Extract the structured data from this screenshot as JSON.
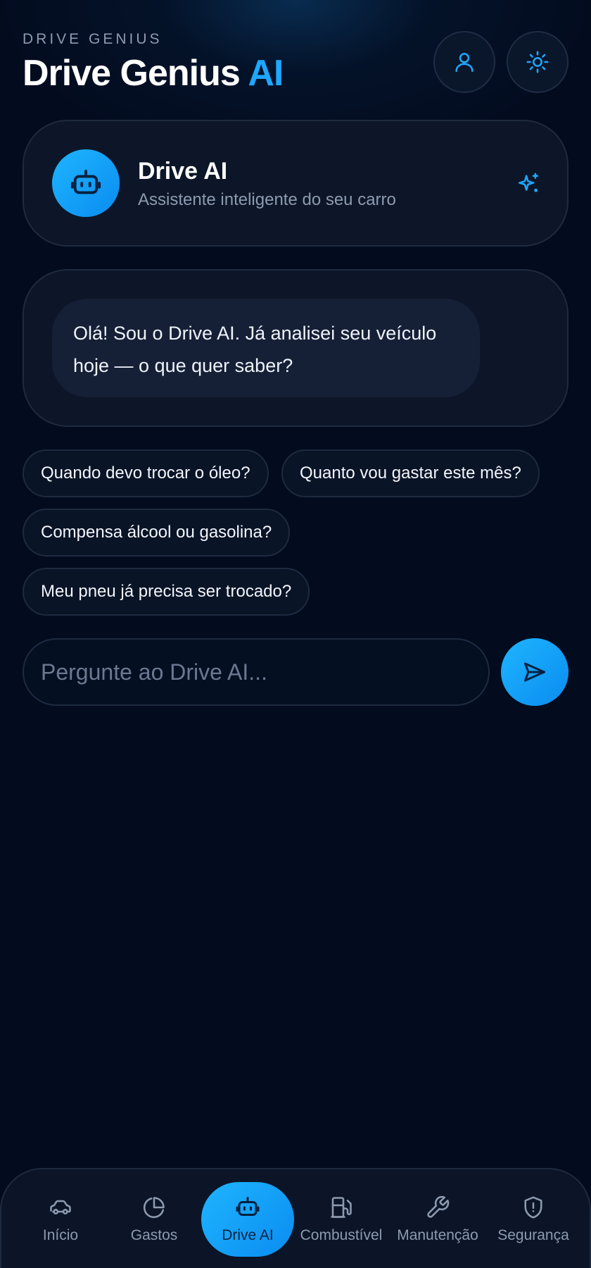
{
  "header": {
    "eyebrow": "DRIVE GENIUS",
    "title_main": "Drive Genius",
    "title_accent": "AI"
  },
  "assistant": {
    "name": "Drive AI",
    "subtitle": "Assistente inteligente do seu carro"
  },
  "chat": {
    "messages": [
      {
        "from": "assistant",
        "text": "Olá! Sou o Drive AI. Já analisei seu veículo hoje — o que quer saber?"
      }
    ]
  },
  "suggestions": [
    "Quando devo trocar o óleo?",
    "Quanto vou gastar este mês?",
    "Compensa álcool ou gasolina?",
    "Meu pneu já precisa ser trocado?"
  ],
  "composer": {
    "placeholder": "Pergunte ao Drive AI...",
    "value": ""
  },
  "nav": {
    "active": "Drive AI",
    "items": [
      {
        "label": "Início",
        "icon": "car-icon"
      },
      {
        "label": "Gastos",
        "icon": "pie-chart-icon"
      },
      {
        "label": "Drive AI",
        "icon": "robot-icon"
      },
      {
        "label": "Combustível",
        "icon": "fuel-pump-icon"
      },
      {
        "label": "Manutenção",
        "icon": "wrench-icon"
      },
      {
        "label": "Segurança",
        "icon": "shield-alert-icon"
      }
    ]
  },
  "colors": {
    "accent": "#1ea7ff",
    "background": "#030c1f",
    "card": "#0c1628",
    "muted_text": "#8d9ab0"
  }
}
